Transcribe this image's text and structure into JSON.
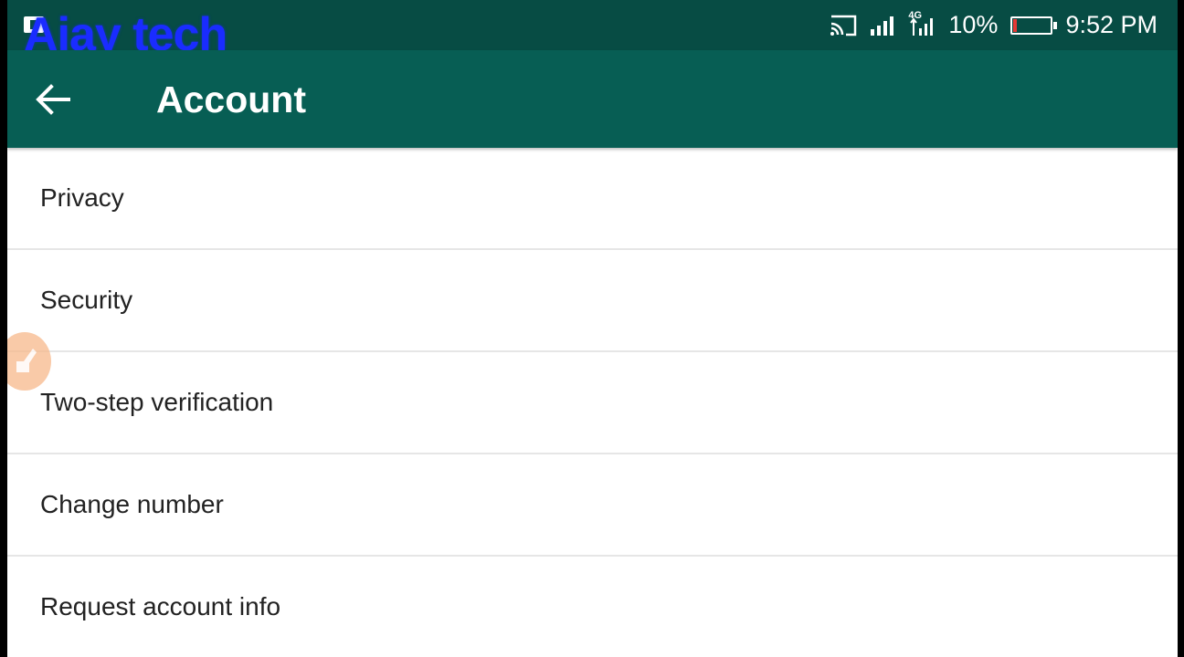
{
  "status_bar": {
    "watermark": "Ajay tech",
    "network_type": "4G",
    "battery_percent": "10%",
    "battery_level": 0.1,
    "time": "9:52 PM",
    "icons": [
      "notification-icon",
      "cast-icon",
      "signal-icon",
      "mobile-data-icon",
      "battery-icon"
    ]
  },
  "app_bar": {
    "back_icon": "arrow-left-icon",
    "title": "Account"
  },
  "menu": {
    "items": [
      {
        "label": "Privacy"
      },
      {
        "label": "Security"
      },
      {
        "label": "Two-step verification"
      },
      {
        "label": "Change number"
      },
      {
        "label": "Request account info"
      }
    ]
  },
  "colors": {
    "status_bar": "#074c44",
    "app_bar": "#075e54",
    "background": "#ffffff",
    "divider": "#e6e6e6",
    "battery_low": "#e53935",
    "watermark": "#1a2cff"
  }
}
